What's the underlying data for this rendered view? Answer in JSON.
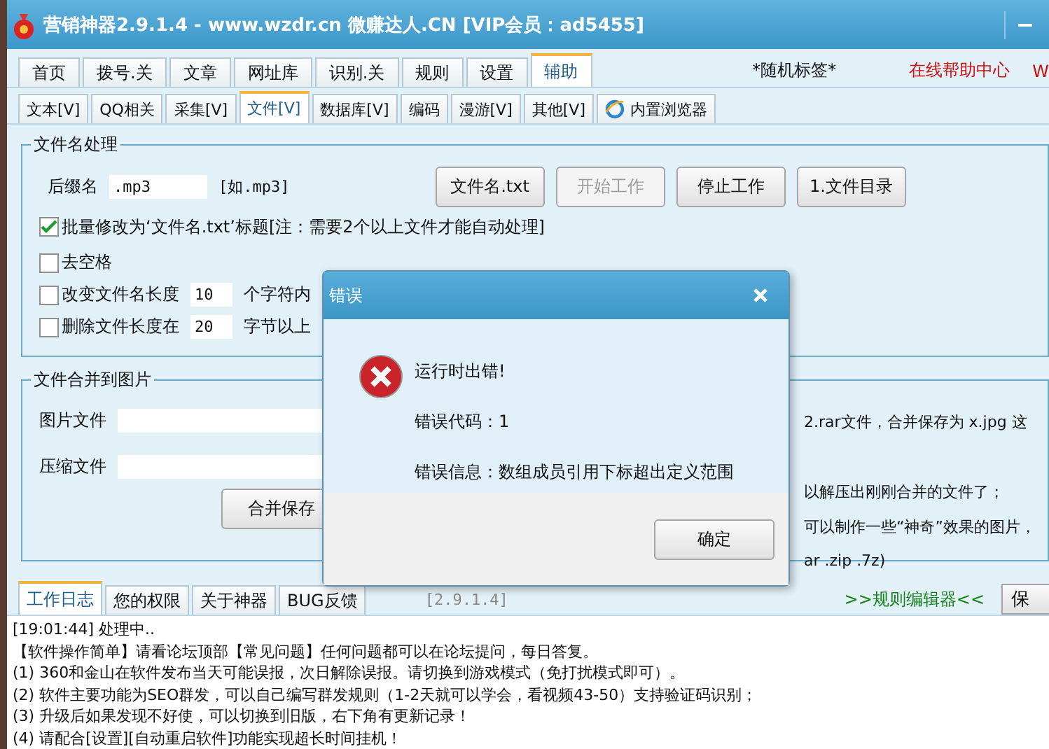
{
  "window": {
    "title": "营销神器2.9.1.4 - www.wzdr.cn 微赚达人.CN [VIP会员：ad5455]"
  },
  "top_tabs": [
    {
      "label": "首页",
      "selected": false
    },
    {
      "label": "拨号.关",
      "selected": false
    },
    {
      "label": "文章",
      "selected": false
    },
    {
      "label": "网址库",
      "selected": false
    },
    {
      "label": "识别.关",
      "selected": false
    },
    {
      "label": "规则",
      "selected": false
    },
    {
      "label": "设置",
      "selected": false
    },
    {
      "label": "辅助",
      "selected": true
    }
  ],
  "random_tag": "*随机标签*",
  "help_links": [
    "在线帮助中心",
    "W"
  ],
  "sub_tabs": [
    {
      "label": "文本[V]",
      "selected": false,
      "kind": "plain"
    },
    {
      "label": "QQ相关",
      "selected": false,
      "kind": "plain"
    },
    {
      "label": "采集[V]",
      "selected": false,
      "kind": "plain"
    },
    {
      "label": "文件[V]",
      "selected": true,
      "kind": "plain"
    },
    {
      "label": "数据库[V]",
      "selected": false,
      "kind": "plain"
    },
    {
      "label": "编码",
      "selected": false,
      "kind": "plain"
    },
    {
      "label": "漫游[V]",
      "selected": false,
      "kind": "plain"
    },
    {
      "label": "其他[V]",
      "selected": false,
      "kind": "plain"
    },
    {
      "label": "内置浏览器",
      "selected": false,
      "kind": "browser"
    }
  ],
  "filename_group": {
    "title": "文件名处理",
    "suffix_label": "后缀名",
    "suffix_value": ".mp3",
    "suffix_hint": "[如.mp3]",
    "buttons": [
      {
        "label": "文件名.txt",
        "disabled": false
      },
      {
        "label": "开始工作",
        "disabled": true
      },
      {
        "label": "停止工作",
        "disabled": false
      },
      {
        "label": "1.文件目录",
        "disabled": false
      }
    ],
    "options": [
      {
        "label": "批量修改为‘文件名.txt’标题[注：需要2个以上文件才能自动处理]",
        "checked": true,
        "kind": "plain"
      },
      {
        "label": "去空格",
        "checked": false,
        "kind": "plain"
      },
      {
        "label": "改变文件名长度",
        "checked": false,
        "kind": "input",
        "value": "10",
        "after": "个字符内"
      },
      {
        "label": "删除文件长度在",
        "checked": false,
        "kind": "input",
        "value": "20",
        "after": "字节以上"
      }
    ]
  },
  "merge_group": {
    "title": "文件合并到图片",
    "fields": [
      "图片文件",
      "压缩文件"
    ],
    "button": "合并保存",
    "notes": [
      "2.rar文件，合并保存为 x.jpg 这",
      "以解压出刚刚合并的文件了；",
      "可以制作一些“神奇”效果的图片，",
      "ar .zip .7z)"
    ]
  },
  "dialog": {
    "title": "错误",
    "lines": [
      "运行时出错!",
      "错误代码：1",
      "错误信息：数组成员引用下标超出定义范围"
    ],
    "button": "确定"
  },
  "bottom_tabs": [
    {
      "label": "工作日志",
      "selected": true
    },
    {
      "label": "您的权限",
      "selected": false
    },
    {
      "label": "关于神器",
      "selected": false
    },
    {
      "label": "BUG反馈",
      "selected": false
    }
  ],
  "version": "[2.9.1.4]",
  "rule_editor": ">>规则编辑器<<",
  "save_button": "保",
  "log_lines": [
    "[19:01:44] 处理中..",
    "【软件操作简单】请看论坛顶部【常见问题】任何问题都可以在论坛提问，每日答复。",
    "(1) 360和金山在软件发布当天可能误报，次日解除误报。请切换到游戏模式（免打扰模式即可）。",
    "(2) 软件主要功能为SEO群发，可以自己编写群发规则（1-2天就可以学会，看视频43-50）支持验证码识别；",
    "(3) 升级后如果发现不好使，可以切换到旧版，右下角有更新记录！",
    "(4) 请配合[设置][自动重启软件]功能实现超长时间挂机！"
  ]
}
